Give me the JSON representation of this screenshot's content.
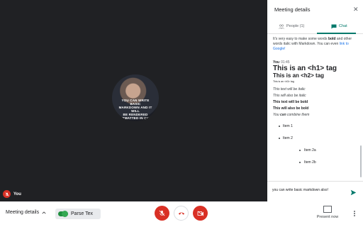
{
  "stage": {
    "avatar_caption": "YOU CAN WRITE BASIC\nMARKDOWN AND IT WILL\nBE RENDERED\nFORMATTED IN CHAT",
    "self_label": "You"
  },
  "panel": {
    "title": "Meeting details",
    "tabs": {
      "people": "People (1)",
      "chat": "Chat"
    },
    "intro": {
      "pre": "It's very easy to make some words ",
      "bold": "bold",
      "mid": " and other words italic with Markdown. You can even ",
      "link": "link to Google!"
    },
    "message": {
      "sender": "You",
      "time": "01:45",
      "h1": "This is an <h1> tag",
      "h2": "This is an <h2> tag",
      "h3": "This is an <h3> tag",
      "italic1": "This text will be italic",
      "italic2": "This will also be italic",
      "bold1": "This text will be bold",
      "bold2": "This will also be bold",
      "combine": {
        "pre": "You ",
        "bold": "can",
        "post": " combine them"
      },
      "items": [
        "Item 1",
        "Item 2",
        "Item 2a",
        "Item 2b"
      ]
    },
    "compose_value": "you can write basic markdown also!"
  },
  "bottom": {
    "meeting_details": "Meeting details",
    "addon": "Parse Tex",
    "present": "Present now"
  },
  "colors": {
    "accent": "#00796b",
    "danger": "#d93025",
    "link": "#1a73e8"
  }
}
